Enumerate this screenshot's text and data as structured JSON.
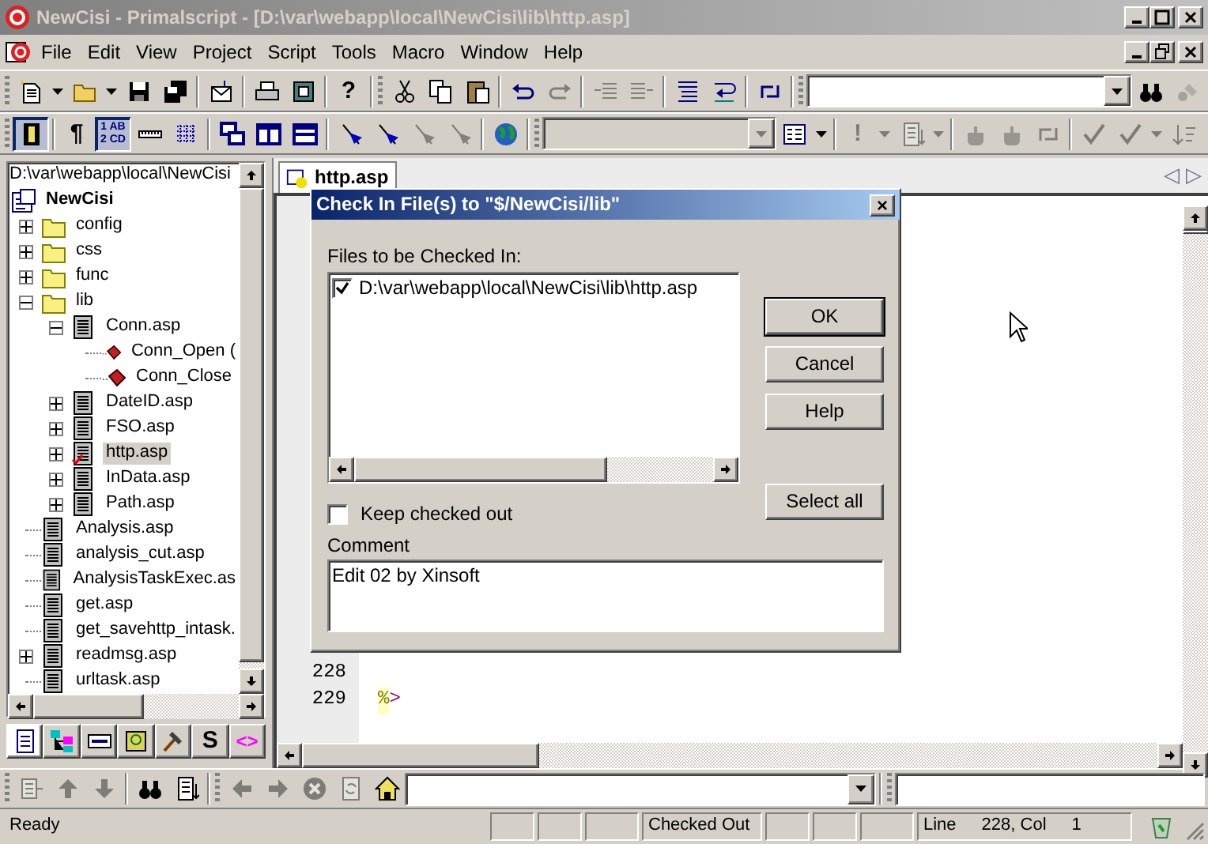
{
  "window": {
    "title": "NewCisi - Primalscript - [D:\\var\\webapp\\local\\NewCisi\\lib\\http.asp]"
  },
  "menu": [
    "File",
    "Edit",
    "View",
    "Project",
    "Script",
    "Tools",
    "Macro",
    "Window",
    "Help"
  ],
  "toolbar_1": [
    {
      "kind": "grip"
    },
    {
      "kind": "new",
      "disabled": false
    },
    {
      "kind": "caret",
      "disabled": false
    },
    {
      "kind": "open",
      "disabled": false
    },
    {
      "kind": "caret",
      "disabled": false
    },
    {
      "kind": "save",
      "disabled": false
    },
    {
      "kind": "saveall",
      "disabled": false
    },
    {
      "kind": "sep"
    },
    {
      "kind": "mail",
      "disabled": false
    },
    {
      "kind": "sep"
    },
    {
      "kind": "print",
      "disabled": false
    },
    {
      "kind": "preview",
      "disabled": false
    },
    {
      "kind": "sep"
    },
    {
      "kind": "glyph",
      "text": "?",
      "disabled": false
    },
    {
      "kind": "sep"
    },
    {
      "kind": "grip"
    },
    {
      "kind": "cut",
      "disabled": false
    },
    {
      "kind": "copy",
      "disabled": false
    },
    {
      "kind": "paste",
      "disabled": false
    },
    {
      "kind": "sep"
    },
    {
      "kind": "undo",
      "disabled": false
    },
    {
      "kind": "redo",
      "disabled": true
    },
    {
      "kind": "sep"
    },
    {
      "kind": "outdent",
      "disabled": true
    },
    {
      "kind": "indent",
      "disabled": true
    },
    {
      "kind": "sep"
    },
    {
      "kind": "lines",
      "disabled": false
    },
    {
      "kind": "wrap",
      "disabled": false
    },
    {
      "kind": "sep"
    },
    {
      "kind": "swap",
      "disabled": false
    },
    {
      "kind": "sep"
    },
    {
      "kind": "grip"
    },
    {
      "kind": "combo",
      "disabled": false
    },
    {
      "kind": "find",
      "disabled": false
    },
    {
      "kind": "replace",
      "disabled": true
    }
  ],
  "toolbar_2": [
    {
      "kind": "grip"
    },
    {
      "kind": "toggle",
      "pressed": true,
      "disabled": false
    },
    {
      "kind": "sep"
    },
    {
      "kind": "glyph",
      "text": "¶",
      "pressed": false,
      "disabled": false
    },
    {
      "kind": "glyph",
      "text": "1 AB 2 CD",
      "pressed": true,
      "disabled": false
    },
    {
      "kind": "ruler",
      "pressed": false,
      "disabled": false
    },
    {
      "kind": "grid",
      "pressed": false,
      "disabled": false
    },
    {
      "kind": "sep"
    },
    {
      "kind": "windows",
      "pressed": false,
      "disabled": false
    },
    {
      "kind": "columns",
      "pressed": false,
      "disabled": false
    },
    {
      "kind": "rows",
      "pressed": false,
      "disabled": false
    },
    {
      "kind": "sep"
    },
    {
      "kind": "flag",
      "pressed": false,
      "disabled": false
    },
    {
      "kind": "flag",
      "pressed": false,
      "disabled": false
    },
    {
      "kind": "flag",
      "pressed": false,
      "disabled": true
    },
    {
      "kind": "flag",
      "pressed": false,
      "disabled": true
    },
    {
      "kind": "sep"
    },
    {
      "kind": "globe",
      "pressed": false,
      "disabled": false
    },
    {
      "kind": "sep"
    },
    {
      "kind": "grip"
    },
    {
      "kind": "combo",
      "disabled": true
    },
    {
      "kind": "form",
      "pressed": false,
      "disabled": false
    },
    {
      "kind": "caret",
      "pressed": false,
      "disabled": false
    },
    {
      "kind": "sep"
    },
    {
      "kind": "glyph",
      "text": "!",
      "pressed": false,
      "disabled": true
    },
    {
      "kind": "caret",
      "pressed": false,
      "disabled": true
    },
    {
      "kind": "list",
      "pressed": false,
      "disabled": true
    },
    {
      "kind": "caret",
      "pressed": false,
      "disabled": true
    },
    {
      "kind": "sep"
    },
    {
      "kind": "pot",
      "pressed": false,
      "disabled": true
    },
    {
      "kind": "pot",
      "pressed": false,
      "disabled": true
    },
    {
      "kind": "swap",
      "pressed": false,
      "disabled": true
    },
    {
      "kind": "sep"
    },
    {
      "kind": "check",
      "pressed": false,
      "disabled": true
    },
    {
      "kind": "check",
      "pressed": false,
      "disabled": true
    },
    {
      "kind": "caret",
      "pressed": false,
      "disabled": true
    },
    {
      "kind": "sort",
      "pressed": false,
      "disabled": true
    }
  ],
  "project_panel": {
    "path": "D:\\var\\webapp\\local\\NewCisi",
    "tree": [
      {
        "label": "NewCisi",
        "kind": "project",
        "selected": false,
        "checked_out": false,
        "children": [
          {
            "label": "config",
            "kind": "folder",
            "expanded": false,
            "selected": false,
            "checked_out": false
          },
          {
            "label": "css",
            "kind": "folder",
            "expanded": false,
            "selected": false,
            "checked_out": false
          },
          {
            "label": "func",
            "kind": "folder",
            "expanded": false,
            "selected": false,
            "checked_out": false
          },
          {
            "label": "lib",
            "kind": "folder",
            "expanded": true,
            "selected": false,
            "checked_out": false,
            "children": [
              {
                "label": "Conn.asp",
                "kind": "file",
                "expanded": true,
                "selected": false,
                "checked_out": false,
                "children": [
                  {
                    "label": "Conn_Open (",
                    "kind": "function",
                    "selected": false,
                    "checked_out": false
                  },
                  {
                    "label": "Conn_Close",
                    "kind": "function",
                    "selected": false,
                    "checked_out": false
                  }
                ]
              },
              {
                "label": "DateID.asp",
                "kind": "file",
                "expanded": false,
                "selected": false,
                "checked_out": false
              },
              {
                "label": "FSO.asp",
                "kind": "file",
                "expanded": false,
                "selected": false,
                "checked_out": false
              },
              {
                "label": "http.asp",
                "kind": "file",
                "expanded": false,
                "selected": true,
                "checked_out": true
              },
              {
                "label": "InData.asp",
                "kind": "file",
                "expanded": false,
                "selected": false,
                "checked_out": false
              },
              {
                "label": "Path.asp",
                "kind": "file",
                "expanded": false,
                "selected": false,
                "checked_out": false
              }
            ]
          },
          {
            "label": "Analysis.asp",
            "kind": "file",
            "selected": false,
            "checked_out": false
          },
          {
            "label": "analysis_cut.asp",
            "kind": "file",
            "selected": false,
            "checked_out": false
          },
          {
            "label": "AnalysisTaskExec.as",
            "kind": "file",
            "selected": false,
            "checked_out": false
          },
          {
            "label": "get.asp",
            "kind": "file",
            "selected": false,
            "checked_out": false
          },
          {
            "label": "get_savehttp_intask.",
            "kind": "file",
            "selected": false,
            "checked_out": false
          },
          {
            "label": "readmsg.asp",
            "kind": "file",
            "expanded": false,
            "selected": false,
            "checked_out": false
          },
          {
            "label": "urltask.asp",
            "kind": "file",
            "selected": false,
            "checked_out": false
          }
        ]
      }
    ],
    "tabs": [
      {
        "kind": "files",
        "selected": true
      },
      {
        "kind": "hierarchy",
        "selected": false
      },
      {
        "kind": "panel",
        "selected": false
      },
      {
        "kind": "library",
        "selected": false
      },
      {
        "kind": "hammer",
        "selected": false
      },
      {
        "kind": "glyph",
        "text": "S",
        "selected": false
      },
      {
        "kind": "glyph",
        "text": "<>",
        "selected": false
      }
    ]
  },
  "editor": {
    "tabs": [
      {
        "label": "http.asp",
        "selected": true
      }
    ],
    "scroll_left": "◁",
    "scroll_right": "▷",
    "lines": [
      {
        "number": "228"
      },
      {
        "number": "229",
        "code": [
          {
            "text": "%",
            "kind": "delimiter"
          },
          {
            "text": ">",
            "kind": "operator"
          }
        ]
      }
    ]
  },
  "bottom_toolbar": [
    {
      "kind": "grip"
    },
    {
      "kind": "listarrow",
      "disabled": true
    },
    {
      "kind": "up",
      "disabled": true
    },
    {
      "kind": "down",
      "disabled": true
    },
    {
      "kind": "sep"
    },
    {
      "kind": "find",
      "disabled": false
    },
    {
      "kind": "list",
      "disabled": false
    },
    {
      "kind": "sep"
    },
    {
      "kind": "grip"
    },
    {
      "kind": "left",
      "disabled": true
    },
    {
      "kind": "right",
      "disabled": true
    },
    {
      "kind": "stop",
      "disabled": true
    },
    {
      "kind": "refresh",
      "disabled": true
    },
    {
      "kind": "home",
      "disabled": false
    },
    {
      "kind": "combo",
      "disabled": false
    },
    {
      "kind": "sep"
    },
    {
      "kind": "grip"
    },
    {
      "kind": "field",
      "disabled": false
    }
  ],
  "dialog": {
    "title": "Check In File(s) to \"$/NewCisi/lib\"",
    "close": "×",
    "files_label": "Files to be Checked In:",
    "files": [
      {
        "path": "D:\\var\\webapp\\local\\NewCisi\\lib\\http.asp",
        "checked": true
      }
    ],
    "buttons": [
      {
        "label": "OK",
        "default": true
      },
      {
        "label": "Cancel",
        "default": false
      },
      {
        "label": "Help",
        "default": false
      },
      {
        "label": "Select all",
        "default": false
      }
    ],
    "keep_checked_out": {
      "label": "Keep checked out",
      "checked": false
    },
    "comment_label": "Comment",
    "comment": "Edit 02 by Xinsoft"
  },
  "status_bar": {
    "message": "Ready",
    "panels": [
      {
        "kind": "empty"
      },
      {
        "kind": "empty"
      },
      {
        "kind": "empty"
      },
      {
        "kind": "text",
        "text": "Checked Out"
      },
      {
        "kind": "empty"
      },
      {
        "kind": "empty"
      },
      {
        "kind": "empty"
      },
      {
        "kind": "position",
        "label": "Line",
        "position": "228, Col",
        "column": "1"
      }
    ]
  }
}
